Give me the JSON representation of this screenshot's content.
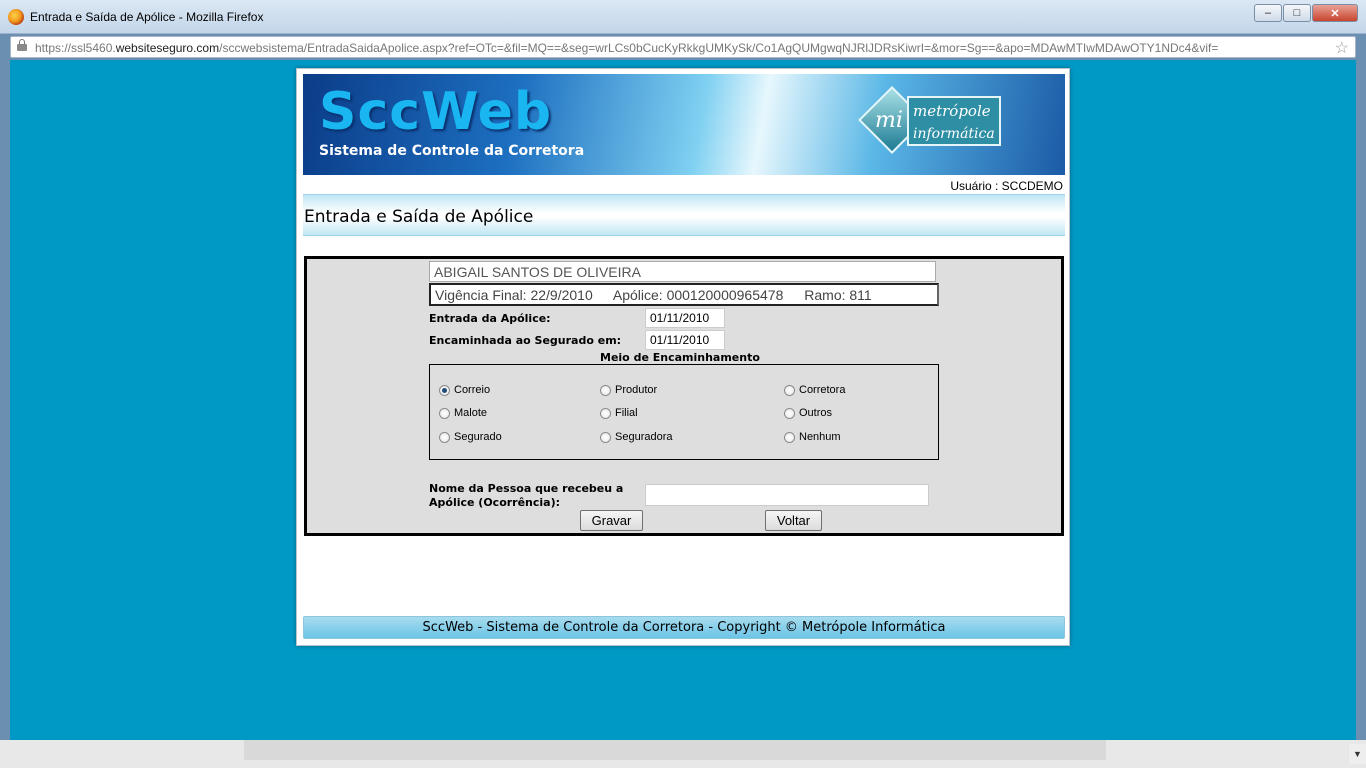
{
  "window": {
    "title": "Entrada e Saída de Apólice - Mozilla Firefox",
    "url_prefix": "https://ssl5460.",
    "url_host": "websiteseguro.com",
    "url_rest": "/sccwebsistema/EntradaSaidaApolice.aspx?ref=OTc=&fil=MQ==&seg=wrLCs0bCucKyRkkgUMKySk/Co1AgQUMgwqNJRlJDRsKiwrI=&mor=Sg==&apo=MDAwMTIwMDAwOTY1NDc4&vif="
  },
  "banner": {
    "title": "SccWeb",
    "subtitle": "Sistema de Controle da Corretora",
    "logo_line1": "metrópole",
    "logo_line2": "informática",
    "logo_mark": "mi"
  },
  "user": {
    "label": "Usuário : SCCDEMO"
  },
  "page": {
    "title": "Entrada e Saída de Apólice"
  },
  "policy": {
    "name": "ABIGAIL SANTOS DE OLIVEIRA",
    "vigencia": "Vigência Final: 22/9/2010",
    "apolice": "Apólice: 000120000965478",
    "ramo": "Ramo: 811"
  },
  "form": {
    "entrada_label": "Entrada da Apólice:",
    "entrada_value": "01/11/2010",
    "encaminhada_label": "Encaminhada ao Segurado em:",
    "encaminhada_value": "01/11/2010",
    "meio_title": "Meio de Encaminhamento",
    "options": {
      "correio": "Correio",
      "produtor": "Produtor",
      "corretora": "Corretora",
      "malote": "Malote",
      "filial": "Filial",
      "outros": "Outros",
      "segurado": "Segurado",
      "seguradora": "Seguradora",
      "nenhum": "Nenhum"
    },
    "selected": "Correio",
    "nome_label_line1": "Nome da Pessoa que recebeu a",
    "nome_label_line2": "Apólice (Ocorrência):",
    "nome_value": "",
    "save_label": "Gravar",
    "back_label": "Voltar"
  },
  "footer": {
    "text": "SccWeb - Sistema de Controle da Corretora - Copyright © Metrópole Informática"
  },
  "colors": {
    "page_bg": "#0099c6",
    "form_bg": "#dedede",
    "footer_bg": "#8fd2ec"
  },
  "icons": {
    "browser": "firefox-icon",
    "secure": "lock-icon",
    "bookmark": "star-icon"
  }
}
